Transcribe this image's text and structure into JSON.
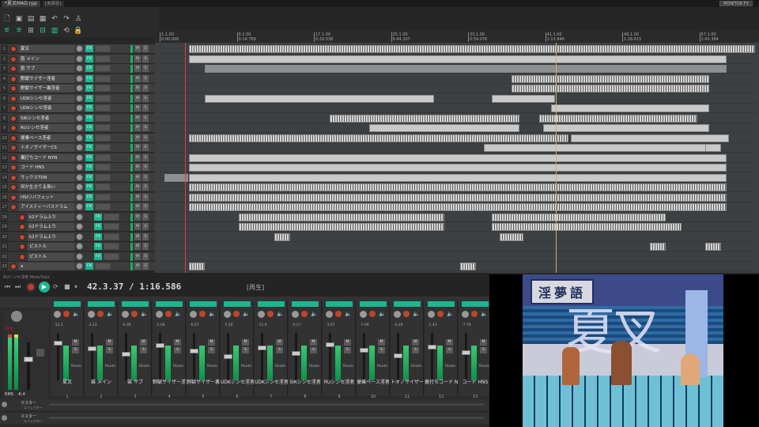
{
  "titlebar": {
    "project_tab": "*夏叉MAD.rpp",
    "unsaved_tab": "[未保存]",
    "monitor_button": "MONITOR FX"
  },
  "toolbar": {
    "icons": [
      "new-file-icon",
      "open-folder-icon",
      "save-icon",
      "settings-icon",
      "undo-icon",
      "redo-icon",
      "metronome-icon",
      "snap-icon",
      "ripple-icon",
      "grid-icon",
      "envelope-icon",
      "item-lock-icon",
      "lock-icon"
    ]
  },
  "ruler": {
    "markers": [
      {
        "bar": "1.1.00",
        "time": "0:00.000"
      },
      {
        "bar": "9.1.00",
        "time": "0:14.769"
      },
      {
        "bar": "17.1.00",
        "time": "0:29.538"
      },
      {
        "bar": "25.1.00",
        "time": "0:44.307"
      },
      {
        "bar": "33.1.00",
        "time": "0:59.076"
      },
      {
        "bar": "41.1.00",
        "time": "1:13.846"
      },
      {
        "bar": "49.1.00",
        "time": "1:28.615"
      },
      {
        "bar": "57.1.00",
        "time": "1:43.384"
      }
    ]
  },
  "tracks": [
    {
      "num": "1",
      "name": "夏叉"
    },
    {
      "num": "2",
      "name": "笛 メイン"
    },
    {
      "num": "3",
      "name": "笛 サブ"
    },
    {
      "num": "4",
      "name": "野獣サイザー淫者"
    },
    {
      "num": "5",
      "name": "野獣サイザー裏淫者"
    },
    {
      "num": "6",
      "name": "UDKシンセ淫者"
    },
    {
      "num": "7",
      "name": "UDKシンセ淫者"
    },
    {
      "num": "8",
      "name": "SIKシンセ淫者"
    },
    {
      "num": "9",
      "name": "RUシンセ淫者"
    },
    {
      "num": "10",
      "name": "便乗ベース淫者"
    },
    {
      "num": "11",
      "name": "トオノサイザーCS"
    },
    {
      "num": "12",
      "name": "裏打ちコード NYN"
    },
    {
      "num": "13",
      "name": "コード HNS"
    },
    {
      "num": "14",
      "name": "サックスTDN"
    },
    {
      "num": "15",
      "name": "何か生きてる臭い"
    },
    {
      "num": "16",
      "name": "HSIリバフェット"
    },
    {
      "num": "17",
      "name": "アイスティーパスドラム"
    },
    {
      "num": "18",
      "name": "k2ドラム上り"
    },
    {
      "num": "19",
      "name": "k2ドラム上り"
    },
    {
      "num": "20",
      "name": "k2ドラム上り"
    },
    {
      "num": "21",
      "name": "ピストル"
    },
    {
      "num": "22",
      "name": "ピストル"
    },
    {
      "num": "23",
      "name": "a"
    }
  ],
  "transport": {
    "position": "42.3.37 / 1:16.586",
    "status": "[再生]",
    "selected_track_label": "RUシンセ淫者 Mute/Solo"
  },
  "mixer": {
    "master_rms_label": "RMS",
    "master_rms_value": "-6.4",
    "master_peak": "-0.9",
    "route_label": "Route",
    "channels": [
      {
        "name": "夏叉",
        "num": "1",
        "db": "-12.3"
      },
      {
        "name": "笛 メイン",
        "num": "2",
        "db": "-3.23"
      },
      {
        "name": "笛 サブ",
        "num": "3",
        "db": "-6.06"
      },
      {
        "name": "野獣サイザー淫",
        "num": "4",
        "db": "-5.08"
      },
      {
        "name": "野獣サイザー裏",
        "num": "5",
        "db": "-6.67"
      },
      {
        "name": "UDKシンセ淫者",
        "num": "6",
        "db": "-5.56"
      },
      {
        "name": "UDKシンセ淫者",
        "num": "7",
        "db": "-11.6"
      },
      {
        "name": "SIKシンセ淫者",
        "num": "8",
        "db": "-0.57"
      },
      {
        "name": "RUシンセ淫者",
        "num": "9",
        "db": "-3.07"
      },
      {
        "name": "便乗ベース淫者",
        "num": "10",
        "db": "-7.08"
      },
      {
        "name": "トオノサイザーCS",
        "num": "11",
        "db": "-4.28"
      },
      {
        "name": "裏打ちコード NY",
        "num": "12",
        "db": "-1.43"
      },
      {
        "name": "コード HNS",
        "num": "13",
        "db": "-7.78"
      }
    ],
    "master_rows": [
      {
        "label": "マスター",
        "sub": "エフェクター"
      },
      {
        "label": "マスター",
        "sub": "エフェクター"
      }
    ]
  },
  "video": {
    "title_text": "夏叉",
    "sign_text": "淫夢語"
  },
  "colors": {
    "accent": "#1cb68f",
    "record": "#d0442c",
    "playhead": "#e43c3c",
    "meter": "#39c773"
  }
}
